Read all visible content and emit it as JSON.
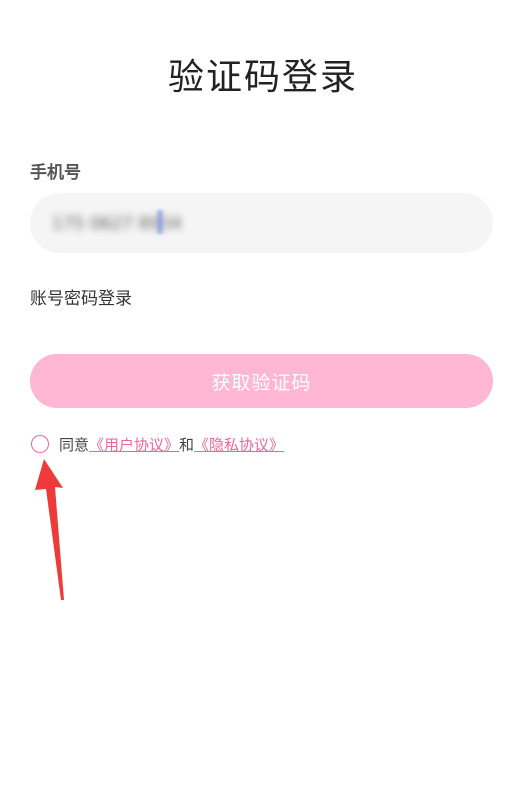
{
  "page": {
    "title": "验证码登录"
  },
  "form": {
    "phone_label": "手机号",
    "phone_value": "175 0627 8934",
    "password_login_link": "账号密码登录",
    "get_code_button": "获取验证码"
  },
  "agreement": {
    "prefix": "同意",
    "user_agreement": "《用户协议》",
    "and": "和",
    "privacy_agreement": "《隐私协议》",
    "checked": false
  },
  "colors": {
    "accent": "#ef6699",
    "button_bg": "#ffb7d3",
    "field_bg": "#f5f5f5",
    "annotation_arrow": "#ef3a3a"
  },
  "annotation": {
    "icon": "red-arrow-icon"
  }
}
